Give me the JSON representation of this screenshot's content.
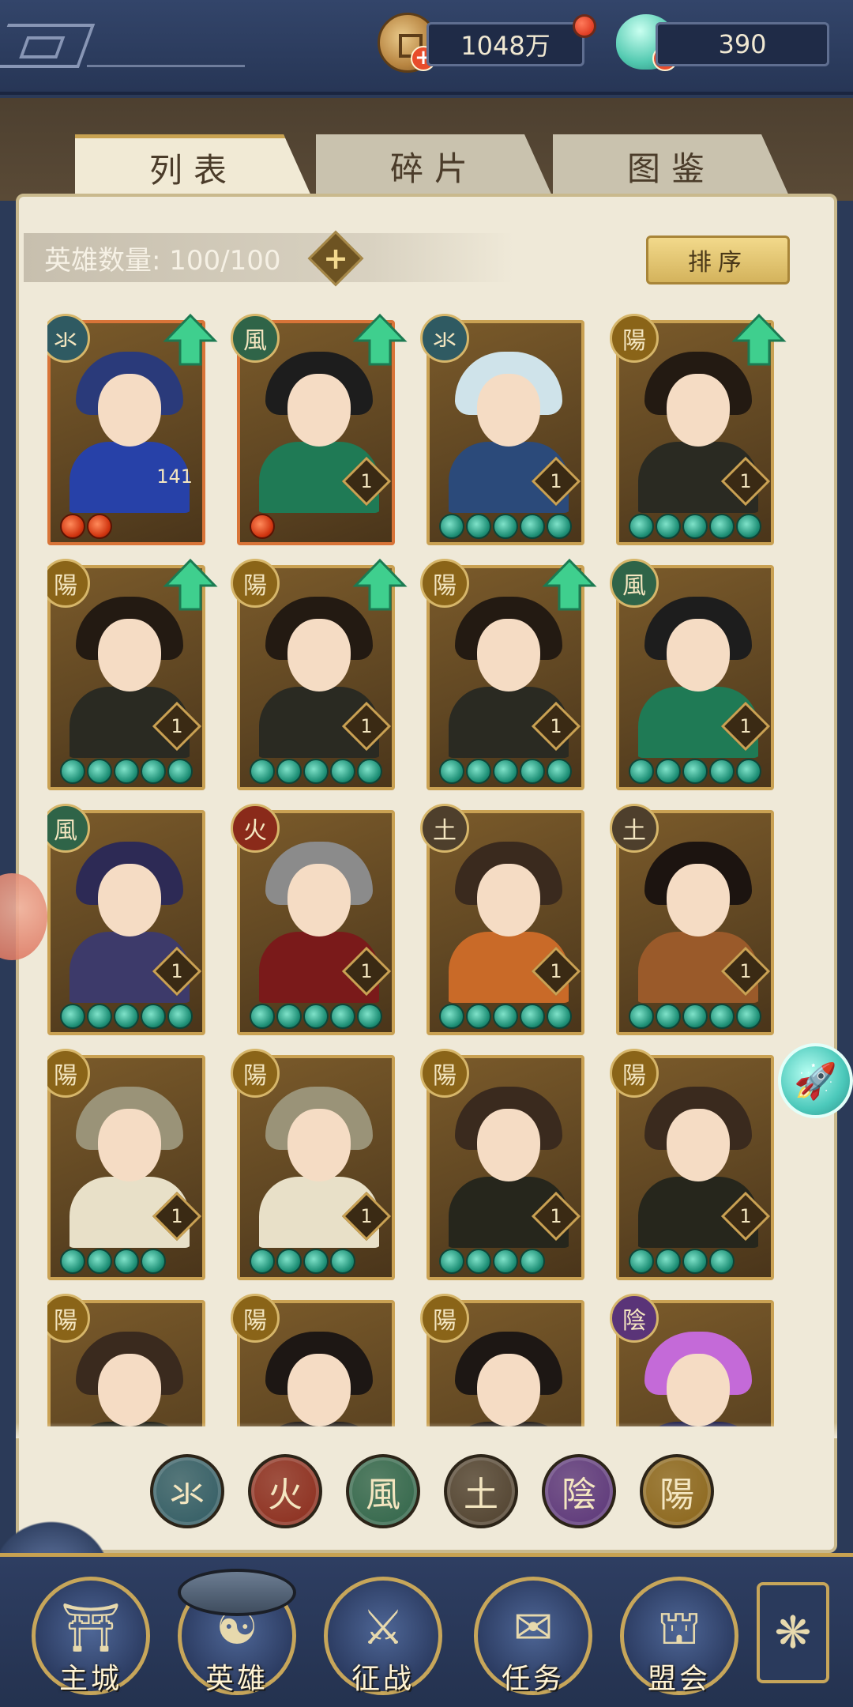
{
  "resources": {
    "coin_value": "1048万",
    "gem_value": "390",
    "plus": "+"
  },
  "tabs": [
    {
      "label": "列表",
      "active": true
    },
    {
      "label": "碎片",
      "active": false
    },
    {
      "label": "图鉴",
      "active": false
    }
  ],
  "hero_count": {
    "label": "英雄数量: 100/100",
    "add": "+"
  },
  "sort_button": "排序",
  "heroes": [
    {
      "element": "氺",
      "elem_color": "#2f5a62",
      "level": "141",
      "stars": 2,
      "star_type": "red",
      "upgrade": true,
      "frame": "red",
      "hair": "#2a3a7a",
      "body": "#2741a8"
    },
    {
      "element": "風",
      "elem_color": "#2f6448",
      "level": "1",
      "stars": 1,
      "star_type": "red",
      "upgrade": true,
      "frame": "red",
      "hair": "#1d1d1d",
      "body": "#1f7a55"
    },
    {
      "element": "氺",
      "elem_color": "#2f5a62",
      "level": "1",
      "stars": 5,
      "star_type": "green",
      "upgrade": false,
      "frame": "gold",
      "hair": "#cfe3ea",
      "body": "#2b4a7a"
    },
    {
      "element": "陽",
      "elem_color": "#8a6418",
      "level": "1",
      "stars": 5,
      "star_type": "green",
      "upgrade": true,
      "frame": "gold",
      "hair": "#231a12",
      "body": "#2a2a22"
    },
    {
      "element": "陽",
      "elem_color": "#8a6418",
      "level": "1",
      "stars": 5,
      "star_type": "green",
      "upgrade": true,
      "frame": "gold",
      "hair": "#231a12",
      "body": "#2a2a22"
    },
    {
      "element": "陽",
      "elem_color": "#8a6418",
      "level": "1",
      "stars": 5,
      "star_type": "green",
      "upgrade": true,
      "frame": "gold",
      "hair": "#231a12",
      "body": "#2a2a22"
    },
    {
      "element": "陽",
      "elem_color": "#8a6418",
      "level": "1",
      "stars": 5,
      "star_type": "green",
      "upgrade": true,
      "frame": "gold",
      "hair": "#231a12",
      "body": "#2a2a22"
    },
    {
      "element": "風",
      "elem_color": "#2f6448",
      "level": "1",
      "stars": 5,
      "star_type": "green",
      "upgrade": false,
      "frame": "gold",
      "hair": "#1d1d1d",
      "body": "#1f7a55"
    },
    {
      "element": "風",
      "elem_color": "#2f6448",
      "level": "1",
      "stars": 5,
      "star_type": "green",
      "upgrade": false,
      "frame": "gold",
      "hair": "#2d2a55",
      "body": "#3d3a6a"
    },
    {
      "element": "火",
      "elem_color": "#8a2a1a",
      "level": "1",
      "stars": 5,
      "star_type": "green",
      "upgrade": false,
      "frame": "gold",
      "hair": "#8b8b8b",
      "body": "#7a1a1a"
    },
    {
      "element": "土",
      "elem_color": "#4e3f2c",
      "level": "1",
      "stars": 5,
      "star_type": "green",
      "upgrade": false,
      "frame": "gold",
      "hair": "#3a2a1e",
      "body": "#c96a28"
    },
    {
      "element": "土",
      "elem_color": "#4e3f2c",
      "level": "1",
      "stars": 5,
      "star_type": "green",
      "upgrade": false,
      "frame": "gold",
      "hair": "#1c1410",
      "body": "#9a5a2a"
    },
    {
      "element": "陽",
      "elem_color": "#8a6418",
      "level": "1",
      "stars": 4,
      "star_type": "green",
      "upgrade": false,
      "frame": "gold",
      "hair": "#9a9378",
      "body": "#e8e0c8"
    },
    {
      "element": "陽",
      "elem_color": "#8a6418",
      "level": "1",
      "stars": 4,
      "star_type": "green",
      "upgrade": false,
      "frame": "gold",
      "hair": "#9a9378",
      "body": "#e8e0c8"
    },
    {
      "element": "陽",
      "elem_color": "#8a6418",
      "level": "1",
      "stars": 4,
      "star_type": "green",
      "upgrade": false,
      "frame": "gold",
      "hair": "#3a2a1e",
      "body": "#26261c"
    },
    {
      "element": "陽",
      "elem_color": "#8a6418",
      "level": "1",
      "stars": 4,
      "star_type": "green",
      "upgrade": false,
      "frame": "gold",
      "hair": "#3a2a1e",
      "body": "#26261c"
    },
    {
      "element": "陽",
      "elem_color": "#8a6418",
      "level": "",
      "stars": 0,
      "star_type": "green",
      "upgrade": false,
      "frame": "gold",
      "hair": "#3a2a1e",
      "body": "#26261c"
    },
    {
      "element": "陽",
      "elem_color": "#8a6418",
      "level": "",
      "stars": 0,
      "star_type": "green",
      "upgrade": false,
      "frame": "gold",
      "hair": "#1d1714",
      "body": "#2a2420"
    },
    {
      "element": "陽",
      "elem_color": "#8a6418",
      "level": "",
      "stars": 0,
      "star_type": "green",
      "upgrade": false,
      "frame": "gold",
      "hair": "#1d1714",
      "body": "#2a2420"
    },
    {
      "element": "陰",
      "elem_color": "#5a3478",
      "level": "",
      "stars": 0,
      "star_type": "green",
      "upgrade": false,
      "frame": "gold",
      "hair": "#c46ad8",
      "body": "#2a2a55"
    }
  ],
  "filters": [
    {
      "element": "氺",
      "color": "#2f5a62"
    },
    {
      "element": "火",
      "color": "#8a2a1a"
    },
    {
      "element": "風",
      "color": "#2f6448"
    },
    {
      "element": "土",
      "color": "#4e3f2c"
    },
    {
      "element": "陰",
      "color": "#5a3478"
    },
    {
      "element": "陽",
      "color": "#8a6418"
    }
  ],
  "nav": [
    {
      "label": "主城",
      "icon": "⛩"
    },
    {
      "label": "英雄",
      "icon": "☯"
    },
    {
      "label": "征战",
      "icon": "⚔"
    },
    {
      "label": "任务",
      "icon": "✉"
    },
    {
      "label": "盟会",
      "icon": "⛫"
    }
  ],
  "nav_extra_icon": "❋",
  "rocket_icon": "🚀"
}
